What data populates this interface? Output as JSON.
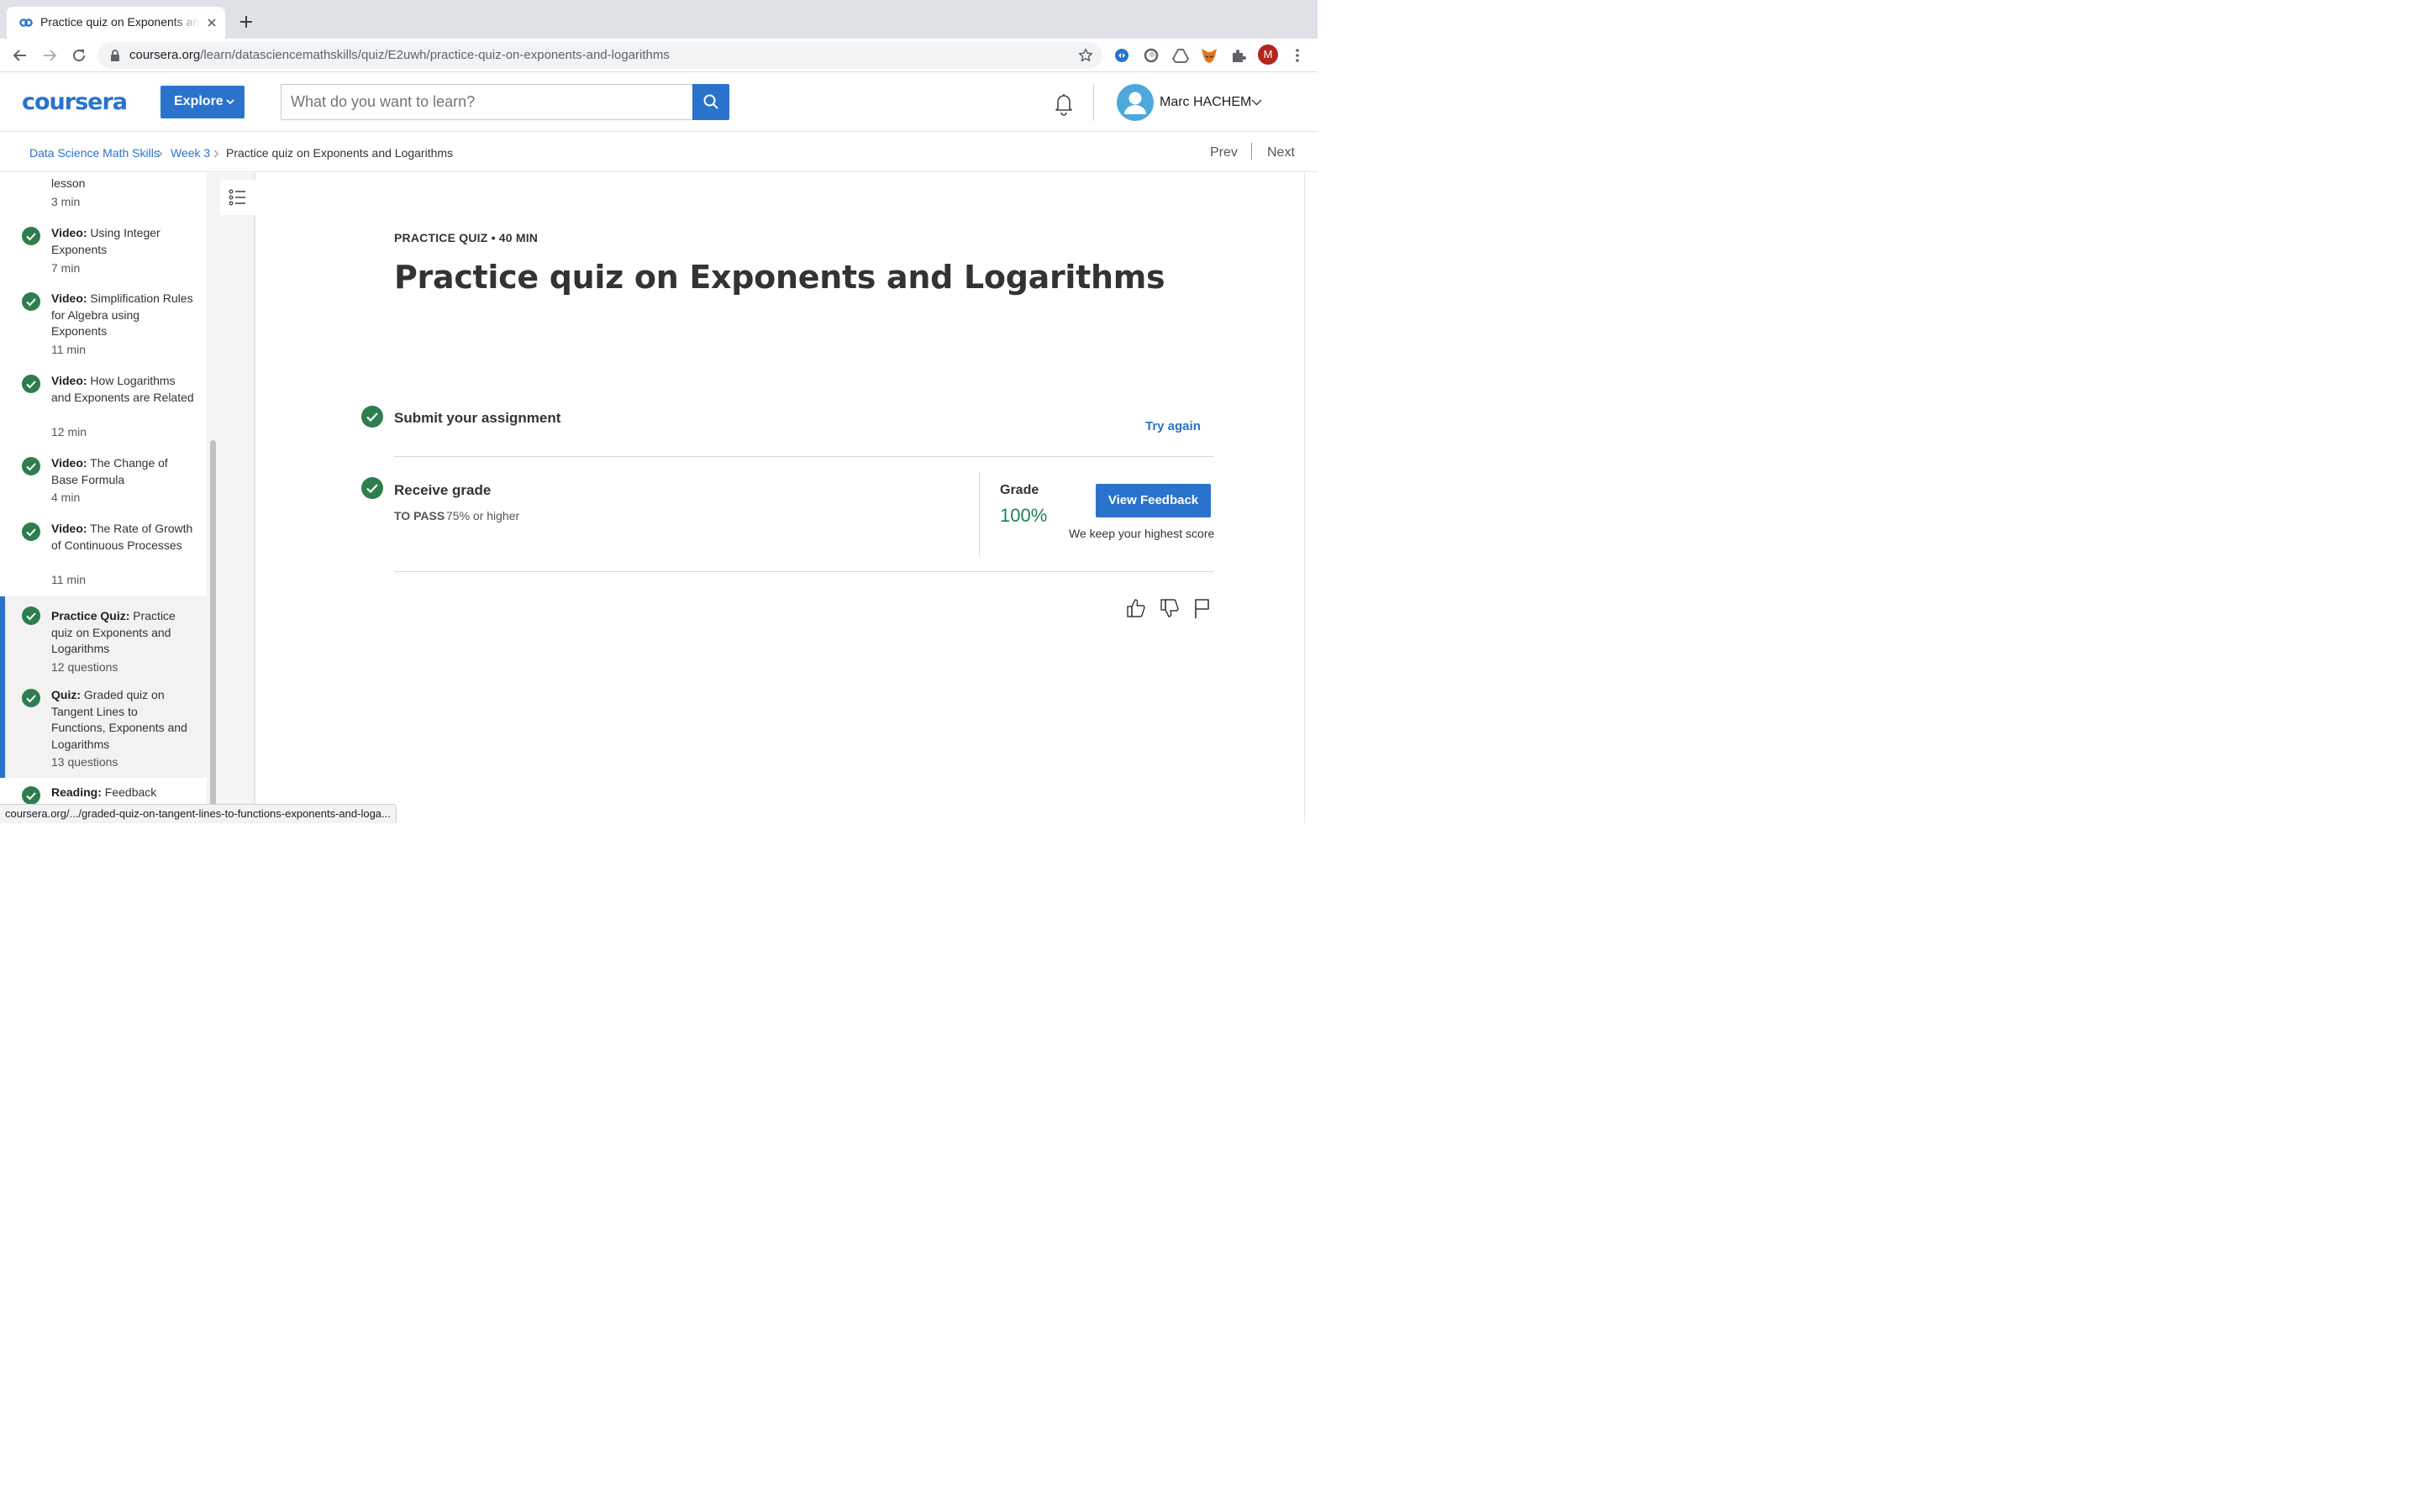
{
  "browser": {
    "tab_title": "Practice quiz on Exponents and Logarithms",
    "url_host": "coursera.org",
    "url_path": "/learn/datasciencemathskills/quiz/E2uwh/practice-quiz-on-exponents-and-logarithms",
    "extension_badge": "3",
    "profile_initial": "M"
  },
  "header": {
    "logo": "coursera",
    "explore_label": "Explore",
    "search_placeholder": "What do you want to learn?",
    "user_name": "Marc HACHEM"
  },
  "breadcrumb": {
    "items": [
      "Data Science Math Skills",
      "Week 3",
      "Practice quiz on Exponents and Logarithms"
    ],
    "prev": "Prev",
    "next": "Next"
  },
  "sidebar": {
    "items": [
      {
        "type": "",
        "title": "lesson",
        "meta": "3 min",
        "active": false
      },
      {
        "type": "Video:",
        "title": "Using Integer Exponents",
        "meta": "7 min",
        "active": false
      },
      {
        "type": "Video:",
        "title": "Simplification Rules for Algebra using Exponents",
        "meta": "11 min",
        "active": false
      },
      {
        "type": "Video:",
        "title": "How Logarithms and Exponents are Related",
        "meta": "12 min",
        "active": false
      },
      {
        "type": "Video:",
        "title": "The Change of Base Formula",
        "meta": "4 min",
        "active": false
      },
      {
        "type": "Video:",
        "title": "The Rate of Growth of Continuous Processes",
        "meta": "11 min",
        "active": false
      },
      {
        "type": "Practice Quiz:",
        "title": "Practice quiz on Exponents and Logarithms",
        "meta": "12 questions",
        "active": true
      },
      {
        "type": "Quiz:",
        "title": "Graded quiz on Tangent Lines to Functions, Exponents and Logarithms",
        "meta": "13 questions",
        "active": false
      },
      {
        "type": "Reading:",
        "title": "Feedback",
        "meta": "",
        "active": false
      }
    ]
  },
  "main": {
    "eyebrow": "PRACTICE QUIZ • 40 MIN",
    "title": "Practice quiz on Exponents and Logarithms",
    "submit_title": "Submit your assignment",
    "try_again": "Try again",
    "receive_title": "Receive grade",
    "to_pass_label": "TO PASS",
    "to_pass_value": "75% or higher",
    "grade_label": "Grade",
    "grade_value": "100%",
    "view_feedback": "View Feedback",
    "keep_note": "We keep your highest score"
  },
  "status_bar": {
    "url": "coursera.org/.../graded-quiz-on-tangent-lines-to-functions-exponents-and-loga..."
  },
  "colors": {
    "brand_blue": "#2a73cc",
    "success_green": "#1f8354",
    "check_green": "#2e7d4f"
  },
  "icons": {
    "check": "check-circle-icon",
    "thumbs_up": "thumbs-up-icon",
    "thumbs_down": "thumbs-down-icon",
    "flag": "flag-icon"
  }
}
